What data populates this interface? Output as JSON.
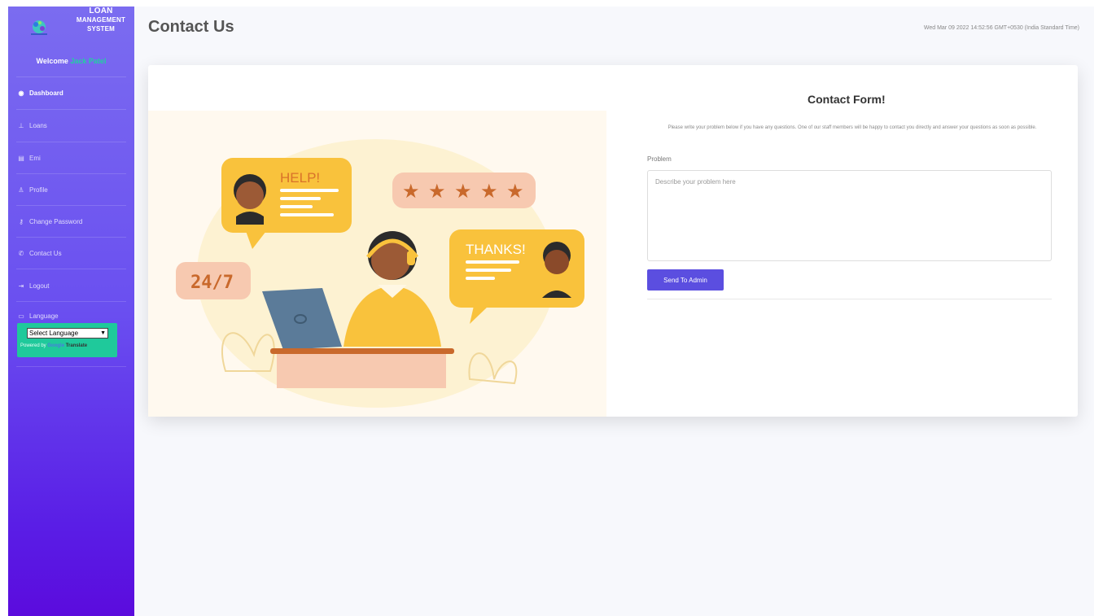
{
  "app": {
    "brand_lines": [
      "LOAN",
      "MANAGEMENT",
      "SYSTEM"
    ],
    "logo_icon": "globe-logo-icon"
  },
  "sidebar": {
    "welcome_prefix": "Welcome",
    "user_name": "Jack Patel",
    "items": [
      {
        "label": "Dashboard",
        "icon": "dashboard-icon",
        "glyph": "◉",
        "active": true
      },
      {
        "label": "Loans",
        "icon": "loans-icon",
        "glyph": "⊥"
      },
      {
        "label": "Emi",
        "icon": "calculator-icon",
        "glyph": "▤"
      },
      {
        "label": "Profile",
        "icon": "user-icon",
        "glyph": "♙"
      },
      {
        "label": "Change Password",
        "icon": "key-icon",
        "glyph": "⚷"
      },
      {
        "label": "Contact Us",
        "icon": "phone-icon",
        "glyph": "✆"
      },
      {
        "label": "Logout",
        "icon": "logout-icon",
        "glyph": "⇥"
      },
      {
        "label": "Language",
        "icon": "language-icon",
        "glyph": "▭"
      }
    ],
    "language_select": "Select Language",
    "powered_by": "Powered by",
    "google": "Google",
    "translate": "Translate"
  },
  "header": {
    "title": "Contact Us",
    "datetime": "Wed Mar 09 2022 14:52:56 GMT+0530 (India Standard Time)"
  },
  "illustration": {
    "bubble_help": "HELP!",
    "bubble_thanks": "THANKS!",
    "badge_247": "24/7",
    "stars": 5
  },
  "form": {
    "title": "Contact Form!",
    "description": "Please write your problem below if you have any questions. One of our staff members will be happy to contact you directly and answer your questions as soon as possible.",
    "field_label": "Problem",
    "placeholder": "Describe your problem here",
    "submit_label": "Send To Admin"
  },
  "colors": {
    "accent": "#5b4ee0",
    "sidebar_top": "#7b6cf0",
    "sidebar_bottom": "#5b0bdd",
    "welcome_name": "#20d0a0",
    "translate_box": "#1fc99b"
  }
}
